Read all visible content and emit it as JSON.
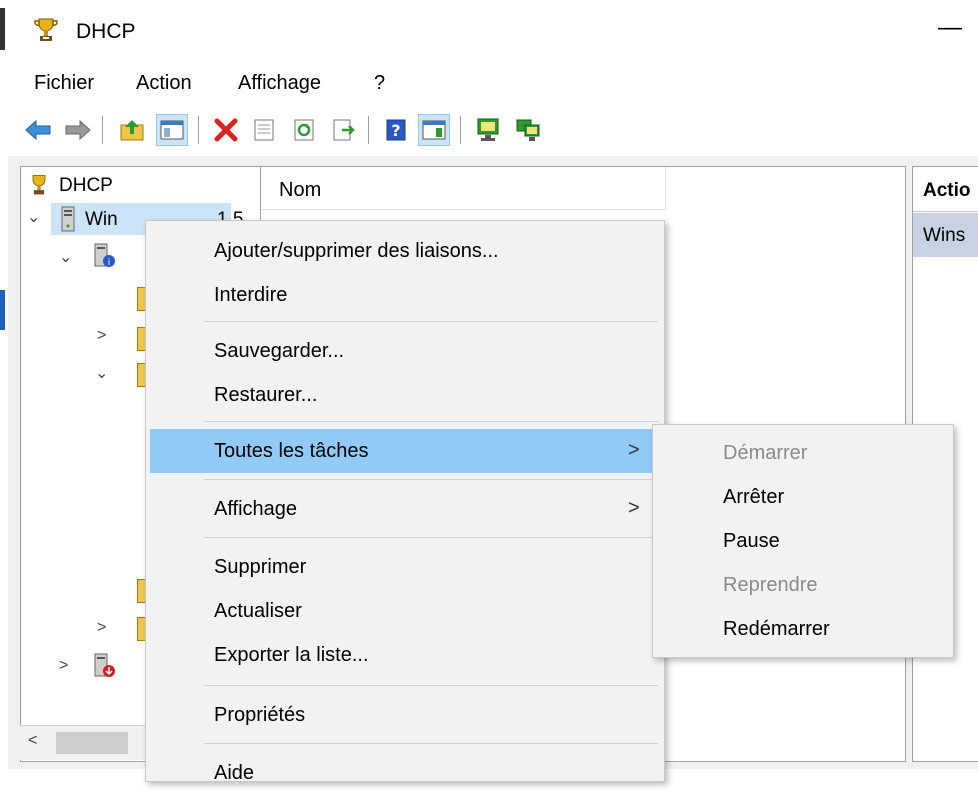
{
  "window": {
    "title": "DHCP",
    "minimize_glyph": "—"
  },
  "menubar": {
    "items": [
      "Fichier",
      "Action",
      "Affichage",
      "?"
    ]
  },
  "toolbar": {
    "icons": [
      "back-arrow-icon",
      "forward-arrow-icon",
      "up-folder-icon",
      "show-hide-console-tree-icon",
      "delete-icon",
      "properties-icon",
      "refresh-icon",
      "export-list-icon",
      "help-icon",
      "show-hide-action-pane-icon",
      "monitor-green-icon",
      "monitor-network-icon"
    ]
  },
  "tree": {
    "root": "DHCP",
    "server": "Win",
    "server_suffix": "1.5"
  },
  "list": {
    "column_name": "Nom"
  },
  "actions_pane": {
    "header": "Actio",
    "server": "Wins"
  },
  "context_menu": {
    "items": [
      {
        "label": "Ajouter/supprimer des liaisons..."
      },
      {
        "label": "Interdire"
      },
      {
        "label": "Sauvegarder..."
      },
      {
        "label": "Restaurer..."
      },
      {
        "label": "Toutes les tâches",
        "submenu": true
      },
      {
        "label": "Affichage",
        "submenu": true
      },
      {
        "label": "Supprimer"
      },
      {
        "label": "Actualiser"
      },
      {
        "label": "Exporter la liste..."
      },
      {
        "label": "Propriétés"
      },
      {
        "label": "Aide"
      }
    ],
    "submenu_arrow": ">"
  },
  "submenu": {
    "items": [
      {
        "label": "Démarrer",
        "enabled": false
      },
      {
        "label": "Arrêter",
        "enabled": true
      },
      {
        "label": "Pause",
        "enabled": true
      },
      {
        "label": "Reprendre",
        "enabled": false
      },
      {
        "label": "Redémarrer",
        "enabled": true
      }
    ]
  },
  "colors": {
    "highlight": "#91c9f7",
    "actions_selected": "#c7d3e3",
    "menu_bg": "#f2f2f2"
  }
}
